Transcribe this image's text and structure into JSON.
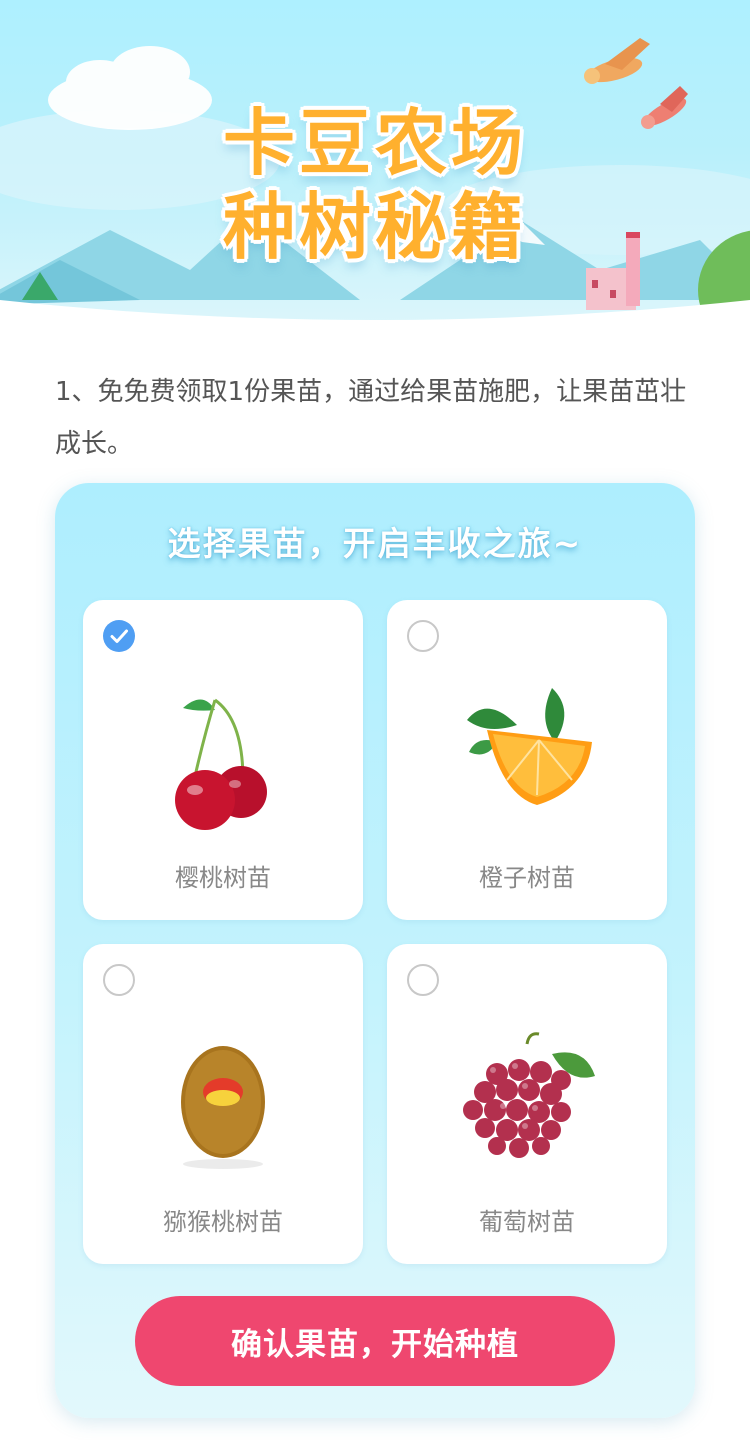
{
  "header": {
    "title_line1": "卡豆农场",
    "title_line2": "种树秘籍"
  },
  "intro": {
    "text": "1、免免费领取1份果苗，通过给果苗施肥，让果苗茁壮成长。"
  },
  "panel": {
    "title": "选择果苗，开启丰收之旅~",
    "options": [
      {
        "label": "樱桃树苗",
        "icon": "cherry-icon",
        "selected": true
      },
      {
        "label": "橙子树苗",
        "icon": "orange-icon",
        "selected": false
      },
      {
        "label": "猕猴桃树苗",
        "icon": "kiwi-icon",
        "selected": false
      },
      {
        "label": "葡萄树苗",
        "icon": "grape-icon",
        "selected": false
      }
    ],
    "confirm_label": "确认果苗，开始种植"
  },
  "colors": {
    "accent": "#ef476f",
    "check": "#4f9ef3",
    "title": "#ffb02e"
  }
}
